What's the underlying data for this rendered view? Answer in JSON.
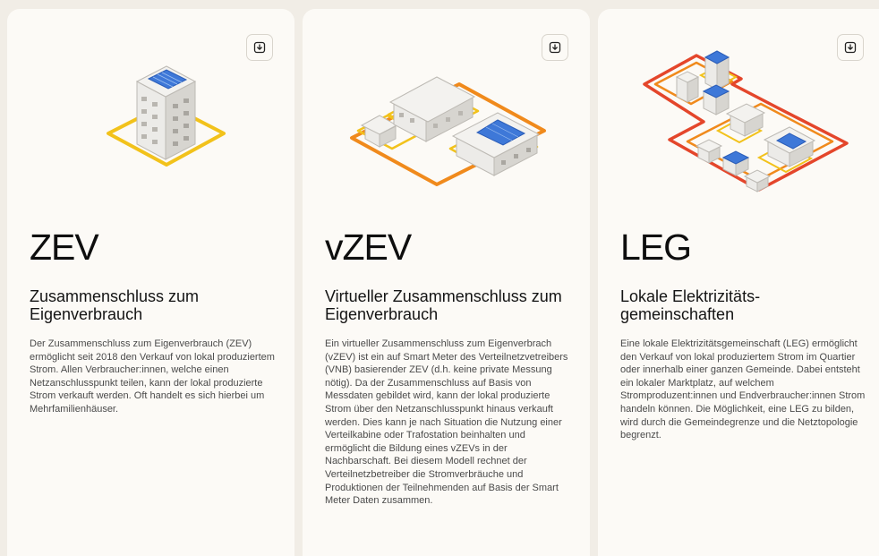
{
  "download_icon": "download-icon",
  "cards": [
    {
      "acronym": "ZEV",
      "subtitle": "Zusammenschluss zum Eigenverbrauch",
      "description": "Der Zusammenschluss zum Eigenverbrauch (ZEV) ermöglicht seit 2018 den Verkauf von lokal produziertem Strom. Allen Verbraucher:innen, welche einen Netzanschlusspunkt teilen, kann der lokal produzierte Strom verkauft werden. Oft handelt es sich hierbei um Mehrfamilienhäuser."
    },
    {
      "acronym": "vZEV",
      "subtitle": "Virtueller Zusammenschluss zum Eigenverbrauch",
      "description": "Ein virtueller Zusammenschluss zum Eigenverbrach (vZEV) ist ein auf Smart Meter des Verteilnetzvetreibers (VNB) basierender ZEV (d.h. keine private Messung nötig). Da der Zusammenschluss auf Basis von Messdaten gebildet wird, kann der lokal produzierte Strom über den Netzanschlusspunkt hinaus verkauft werden. Dies kann je nach Situation die Nutzung einer Verteilkabine oder Trafostation beinhalten und ermöglicht die Bildung eines vZEVs in der Nachbarschaft. Bei diesem Modell rechnet der Verteilnetzbetreiber die Stromverbräuche und Produktionen der Teilnehmenden auf Basis der Smart Meter Daten zusammen."
    },
    {
      "acronym": "LEG",
      "subtitle": "Lokale Elektrizitäts-gemeinschaften",
      "description": "Eine lokale Elektrizitätsgemeinschaft (LEG) ermöglicht den Verkauf von lokal produziertem Strom im Quartier oder innerhalb einer ganzen Gemeinde. Dabei entsteht ein lokaler Marktplatz, auf welchem Stromproduzent:innen und Endverbraucher:innen Strom handeln können. Die Möglichkeit, eine LEG zu bilden, wird durch die Gemeindegrenze und die Netztopologie begrenzt."
    }
  ],
  "colors": {
    "background": "#f1ede6",
    "card": "#fcfaf6",
    "yellow": "#f2c21b",
    "orange": "#f08a1c",
    "red": "#e4462b",
    "solar": "#3e78d8"
  }
}
